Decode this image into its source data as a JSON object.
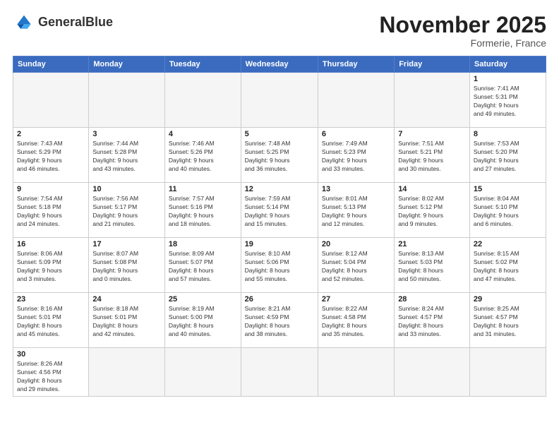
{
  "logo": {
    "text_normal": "General",
    "text_bold": "Blue"
  },
  "title": "November 2025",
  "subtitle": "Formerie, France",
  "days_of_week": [
    "Sunday",
    "Monday",
    "Tuesday",
    "Wednesday",
    "Thursday",
    "Friday",
    "Saturday"
  ],
  "weeks": [
    [
      {
        "day": "",
        "info": ""
      },
      {
        "day": "",
        "info": ""
      },
      {
        "day": "",
        "info": ""
      },
      {
        "day": "",
        "info": ""
      },
      {
        "day": "",
        "info": ""
      },
      {
        "day": "",
        "info": ""
      },
      {
        "day": "1",
        "info": "Sunrise: 7:41 AM\nSunset: 5:31 PM\nDaylight: 9 hours\nand 49 minutes."
      }
    ],
    [
      {
        "day": "2",
        "info": "Sunrise: 7:43 AM\nSunset: 5:29 PM\nDaylight: 9 hours\nand 46 minutes."
      },
      {
        "day": "3",
        "info": "Sunrise: 7:44 AM\nSunset: 5:28 PM\nDaylight: 9 hours\nand 43 minutes."
      },
      {
        "day": "4",
        "info": "Sunrise: 7:46 AM\nSunset: 5:26 PM\nDaylight: 9 hours\nand 40 minutes."
      },
      {
        "day": "5",
        "info": "Sunrise: 7:48 AM\nSunset: 5:25 PM\nDaylight: 9 hours\nand 36 minutes."
      },
      {
        "day": "6",
        "info": "Sunrise: 7:49 AM\nSunset: 5:23 PM\nDaylight: 9 hours\nand 33 minutes."
      },
      {
        "day": "7",
        "info": "Sunrise: 7:51 AM\nSunset: 5:21 PM\nDaylight: 9 hours\nand 30 minutes."
      },
      {
        "day": "8",
        "info": "Sunrise: 7:53 AM\nSunset: 5:20 PM\nDaylight: 9 hours\nand 27 minutes."
      }
    ],
    [
      {
        "day": "9",
        "info": "Sunrise: 7:54 AM\nSunset: 5:18 PM\nDaylight: 9 hours\nand 24 minutes."
      },
      {
        "day": "10",
        "info": "Sunrise: 7:56 AM\nSunset: 5:17 PM\nDaylight: 9 hours\nand 21 minutes."
      },
      {
        "day": "11",
        "info": "Sunrise: 7:57 AM\nSunset: 5:16 PM\nDaylight: 9 hours\nand 18 minutes."
      },
      {
        "day": "12",
        "info": "Sunrise: 7:59 AM\nSunset: 5:14 PM\nDaylight: 9 hours\nand 15 minutes."
      },
      {
        "day": "13",
        "info": "Sunrise: 8:01 AM\nSunset: 5:13 PM\nDaylight: 9 hours\nand 12 minutes."
      },
      {
        "day": "14",
        "info": "Sunrise: 8:02 AM\nSunset: 5:12 PM\nDaylight: 9 hours\nand 9 minutes."
      },
      {
        "day": "15",
        "info": "Sunrise: 8:04 AM\nSunset: 5:10 PM\nDaylight: 9 hours\nand 6 minutes."
      }
    ],
    [
      {
        "day": "16",
        "info": "Sunrise: 8:06 AM\nSunset: 5:09 PM\nDaylight: 9 hours\nand 3 minutes."
      },
      {
        "day": "17",
        "info": "Sunrise: 8:07 AM\nSunset: 5:08 PM\nDaylight: 9 hours\nand 0 minutes."
      },
      {
        "day": "18",
        "info": "Sunrise: 8:09 AM\nSunset: 5:07 PM\nDaylight: 8 hours\nand 57 minutes."
      },
      {
        "day": "19",
        "info": "Sunrise: 8:10 AM\nSunset: 5:06 PM\nDaylight: 8 hours\nand 55 minutes."
      },
      {
        "day": "20",
        "info": "Sunrise: 8:12 AM\nSunset: 5:04 PM\nDaylight: 8 hours\nand 52 minutes."
      },
      {
        "day": "21",
        "info": "Sunrise: 8:13 AM\nSunset: 5:03 PM\nDaylight: 8 hours\nand 50 minutes."
      },
      {
        "day": "22",
        "info": "Sunrise: 8:15 AM\nSunset: 5:02 PM\nDaylight: 8 hours\nand 47 minutes."
      }
    ],
    [
      {
        "day": "23",
        "info": "Sunrise: 8:16 AM\nSunset: 5:01 PM\nDaylight: 8 hours\nand 45 minutes."
      },
      {
        "day": "24",
        "info": "Sunrise: 8:18 AM\nSunset: 5:01 PM\nDaylight: 8 hours\nand 42 minutes."
      },
      {
        "day": "25",
        "info": "Sunrise: 8:19 AM\nSunset: 5:00 PM\nDaylight: 8 hours\nand 40 minutes."
      },
      {
        "day": "26",
        "info": "Sunrise: 8:21 AM\nSunset: 4:59 PM\nDaylight: 8 hours\nand 38 minutes."
      },
      {
        "day": "27",
        "info": "Sunrise: 8:22 AM\nSunset: 4:58 PM\nDaylight: 8 hours\nand 35 minutes."
      },
      {
        "day": "28",
        "info": "Sunrise: 8:24 AM\nSunset: 4:57 PM\nDaylight: 8 hours\nand 33 minutes."
      },
      {
        "day": "29",
        "info": "Sunrise: 8:25 AM\nSunset: 4:57 PM\nDaylight: 8 hours\nand 31 minutes."
      }
    ],
    [
      {
        "day": "30",
        "info": "Sunrise: 8:26 AM\nSunset: 4:56 PM\nDaylight: 8 hours\nand 29 minutes."
      },
      {
        "day": "",
        "info": ""
      },
      {
        "day": "",
        "info": ""
      },
      {
        "day": "",
        "info": ""
      },
      {
        "day": "",
        "info": ""
      },
      {
        "day": "",
        "info": ""
      },
      {
        "day": "",
        "info": ""
      }
    ]
  ]
}
